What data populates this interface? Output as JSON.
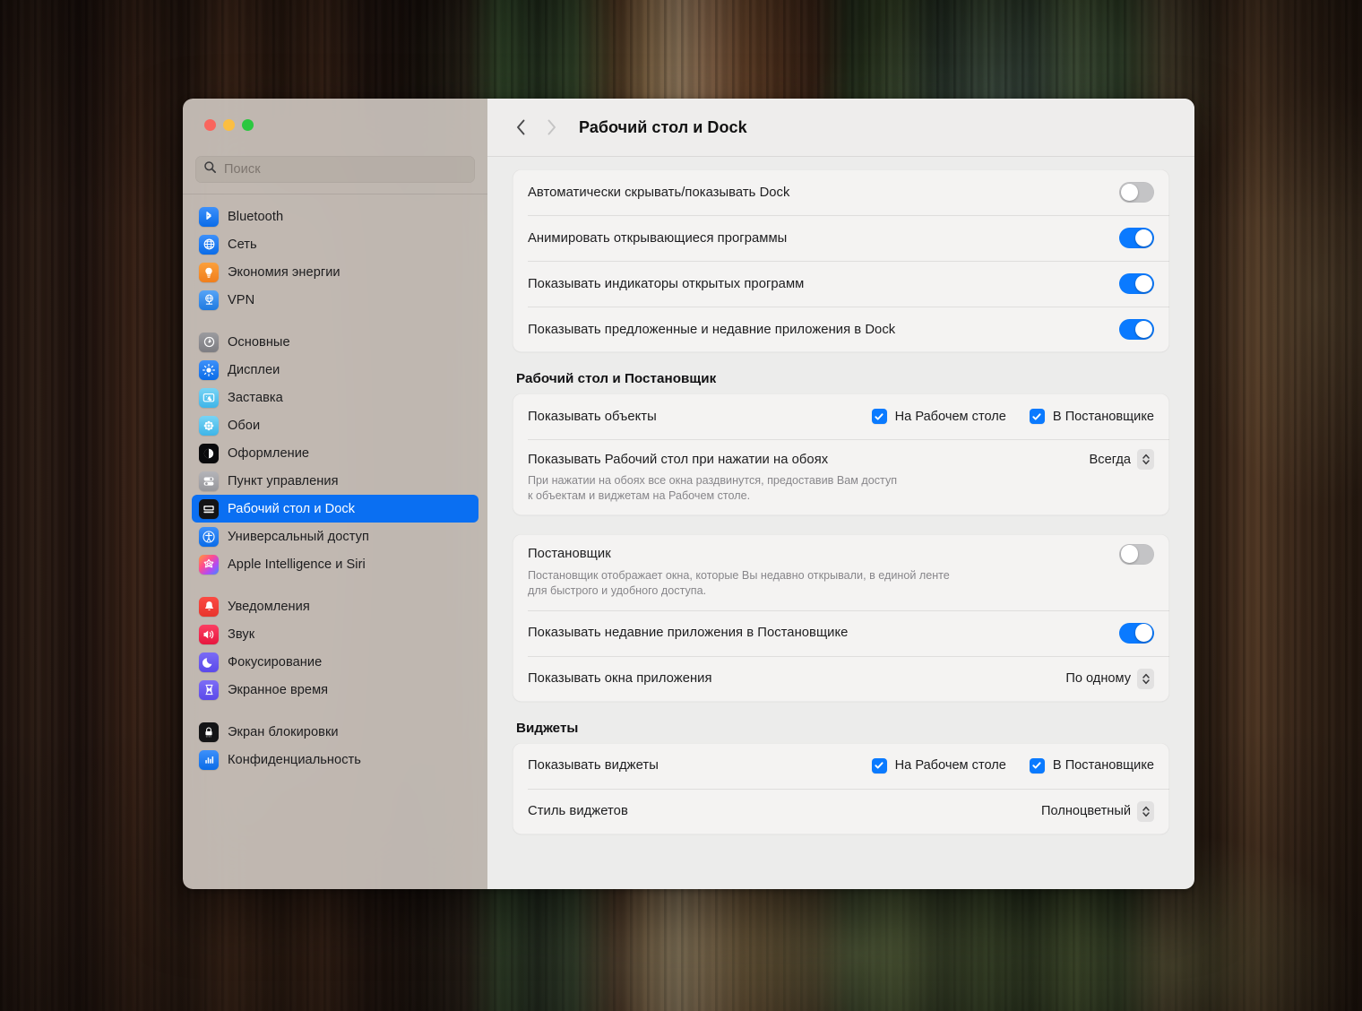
{
  "window": {
    "traffic_lights": [
      "close",
      "minimize",
      "zoom"
    ],
    "title": "Рабочий стол и Dock"
  },
  "search": {
    "placeholder": "Поиск",
    "value": ""
  },
  "sidebar": {
    "groups": [
      {
        "items": [
          {
            "label": "Bluetooth",
            "icon": "bluetooth-icon",
            "selected": false
          },
          {
            "label": "Сеть",
            "icon": "network-globe-icon",
            "selected": false
          },
          {
            "label": "Экономия энергии",
            "icon": "energy-bulb-icon",
            "selected": false
          },
          {
            "label": "VPN",
            "icon": "vpn-icon",
            "selected": false
          }
        ]
      },
      {
        "items": [
          {
            "label": "Основные",
            "icon": "gear-icon",
            "selected": false
          },
          {
            "label": "Дисплеи",
            "icon": "brightness-icon",
            "selected": false
          },
          {
            "label": "Заставка",
            "icon": "screensaver-icon",
            "selected": false
          },
          {
            "label": "Обои",
            "icon": "wallpaper-flower-icon",
            "selected": false
          },
          {
            "label": "Оформление",
            "icon": "appearance-icon",
            "selected": false
          },
          {
            "label": "Пункт управления",
            "icon": "control-center-icon",
            "selected": false
          },
          {
            "label": "Рабочий стол и Dock",
            "icon": "desktop-dock-icon",
            "selected": true
          },
          {
            "label": "Универсальный доступ",
            "icon": "accessibility-icon",
            "selected": false
          },
          {
            "label": "Apple Intelligence и Siri",
            "icon": "siri-icon",
            "selected": false
          }
        ]
      },
      {
        "items": [
          {
            "label": "Уведомления",
            "icon": "notifications-bell-icon",
            "selected": false
          },
          {
            "label": "Звук",
            "icon": "sound-speaker-icon",
            "selected": false
          },
          {
            "label": "Фокусирование",
            "icon": "focus-moon-icon",
            "selected": false
          },
          {
            "label": "Экранное время",
            "icon": "screen-time-icon",
            "selected": false
          }
        ]
      },
      {
        "items": [
          {
            "label": "Экран блокировки",
            "icon": "lock-screen-icon",
            "selected": false
          },
          {
            "label": "Конфиденциальность",
            "icon": "privacy-icon",
            "selected": false
          }
        ]
      }
    ]
  },
  "toolbar": {
    "back_label": "Назад",
    "forward_label": "Вперёд",
    "title": "Рабочий стол и Dock"
  },
  "main": {
    "dock_card": {
      "rows": [
        {
          "label": "Автоматически скрывать/показывать Dock",
          "control": "toggle",
          "value": "off"
        },
        {
          "label": "Анимировать открывающиеся программы",
          "control": "toggle",
          "value": "on"
        },
        {
          "label": "Показывать индикаторы открытых программ",
          "control": "toggle",
          "value": "on"
        },
        {
          "label": "Показывать предложенные и недавние приложения в Dock",
          "control": "toggle",
          "value": "on"
        }
      ]
    },
    "desktop_section": {
      "title": "Рабочий стол и Постановщик",
      "show_items": {
        "label": "Показывать объекты",
        "checkbox_desktop": {
          "label": "На Рабочем столе",
          "checked": true
        },
        "checkbox_stage": {
          "label": "В Постановщике",
          "checked": true
        }
      },
      "click_wallpaper": {
        "label": "Показывать Рабочий стол при нажатии на обоях",
        "value": "Всегда",
        "description_line1": "При нажатии на обоях все окна раздвинутся, предоставив Вам доступ",
        "description_line2": "к объектам и виджетам на Рабочем столе."
      }
    },
    "stage_card": {
      "stage_manager": {
        "label": "Постановщик",
        "toggle": "off",
        "description_line1": "Постановщик отображает окна, которые Вы недавно открывали, в единой ленте",
        "description_line2": "для быстрого и удобного доступа."
      },
      "recent_apps": {
        "label": "Показывать недавние приложения в Постановщике",
        "toggle": "on"
      },
      "show_windows": {
        "label": "Показывать окна приложения",
        "value": "По одному"
      }
    },
    "widgets_section": {
      "title": "Виджеты",
      "show_widgets": {
        "label": "Показывать виджеты",
        "checkbox_desktop": {
          "label": "На Рабочем столе",
          "checked": true
        },
        "checkbox_stage": {
          "label": "В Постановщике",
          "checked": true
        }
      },
      "widget_style": {
        "label": "Стиль виджетов",
        "value": "Полноцветный"
      }
    }
  },
  "colors": {
    "accent_blue": "#0a7aff",
    "selection_blue": "#0a6ff2",
    "traffic_red": "#f9655d",
    "traffic_yellow": "#fbbe41",
    "traffic_green": "#2bc840",
    "card_bg": "#f4f3f2",
    "pane_bg": "#ececeb"
  }
}
